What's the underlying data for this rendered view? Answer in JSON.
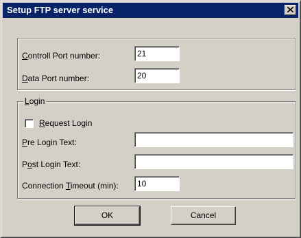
{
  "dialog": {
    "title": "Setup FTP server service"
  },
  "ports": {
    "control": {
      "label_ul": "C",
      "label_rest": "ontroll Port number:",
      "value": "21"
    },
    "data": {
      "label_ul": "D",
      "label_rest": "ata Port number:",
      "value": "20"
    }
  },
  "login": {
    "legend_ul": "L",
    "legend_rest": "ogin",
    "request_login": {
      "label_ul": "R",
      "label_rest": "equest Login",
      "checked": false
    },
    "pre_login": {
      "label_ul": "P",
      "label_rest": "re Login Text:",
      "value": ""
    },
    "post_login": {
      "label_pre": "P",
      "label_ul": "o",
      "label_rest": "st Login Text:",
      "value": ""
    },
    "timeout": {
      "label_pre": "Connection ",
      "label_ul": "T",
      "label_rest": "imeout (min):",
      "value": "10"
    }
  },
  "buttons": {
    "ok": "OK",
    "cancel": "Cancel"
  }
}
